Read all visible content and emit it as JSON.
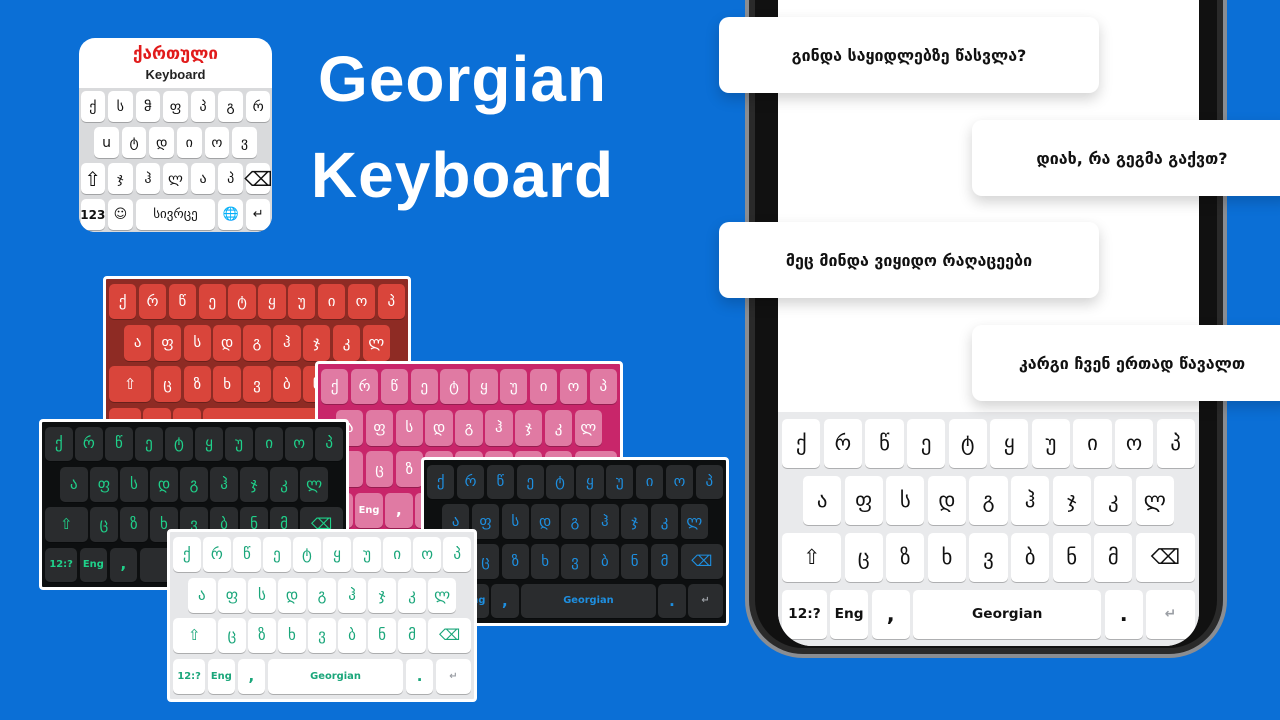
{
  "app_icon": {
    "title": "ქართული",
    "subtitle": "Keyboard",
    "rows": [
      [
        "ქ",
        "ს",
        "ჵ",
        "ფ",
        "პ",
        "გ",
        "რ"
      ],
      [
        "ս",
        "ტ",
        "დ",
        "ი",
        "ო",
        "ვ"
      ],
      [
        "⇧",
        "ჯ",
        "ჰ",
        "ლ",
        "ა",
        "პ",
        "⌫"
      ],
      [
        "123",
        "☺",
        "სივრცე",
        "🌐",
        "↵"
      ]
    ]
  },
  "headline": {
    "line1": "Georgian",
    "line2": "Keyboard"
  },
  "chat": {
    "messages": [
      {
        "text": "გინდა საყიდლებზე წასვლა?",
        "side": "left"
      },
      {
        "text": "დიახ, რა გეგმა გაქვთ?",
        "side": "right"
      },
      {
        "text": "მეც მინდა ვიყიდო რაღაცეები",
        "side": "left"
      },
      {
        "text": "კარგი ჩვენ ერთად წავალთ",
        "side": "right"
      }
    ]
  },
  "keyboard": {
    "row1": [
      "ქ",
      "რ",
      "წ",
      "ე",
      "ტ",
      "ყ",
      "უ",
      "ი",
      "ო",
      "პ"
    ],
    "row2": [
      "ა",
      "ფ",
      "ს",
      "დ",
      "გ",
      "ჰ",
      "ჯ",
      "კ",
      "ლ"
    ],
    "row3": [
      "ც",
      "ზ",
      "ხ",
      "ვ",
      "ბ",
      "ნ",
      "მ"
    ],
    "shift_icon": "⇧",
    "backspace_icon": "⌫",
    "numbers_label": "12:?",
    "lang_label": "Eng",
    "comma": ",",
    "space_label": "Georgian",
    "period": ".",
    "enter_icon": "↵"
  },
  "themes": [
    {
      "name": "red",
      "bg": "#8e2b24",
      "key": "#d9453b",
      "text": "#ffffff"
    },
    {
      "name": "pink",
      "bg": "#c8266a",
      "key": "#e07aa3",
      "text": "#ffffff"
    },
    {
      "name": "dark-green",
      "bg": "#0d0f10",
      "key": "#2a2c2e",
      "text": "#1fd18a"
    },
    {
      "name": "dark-blue",
      "bg": "#0d0f10",
      "key": "#2a2c2e",
      "text": "#1e8fe0"
    },
    {
      "name": "white-green",
      "bg": "#e6e7e9",
      "key": "#ffffff",
      "text": "#1aa67a"
    },
    {
      "name": "white",
      "bg": "#e9eaec",
      "key": "#ffffff",
      "text": "#111111"
    }
  ]
}
